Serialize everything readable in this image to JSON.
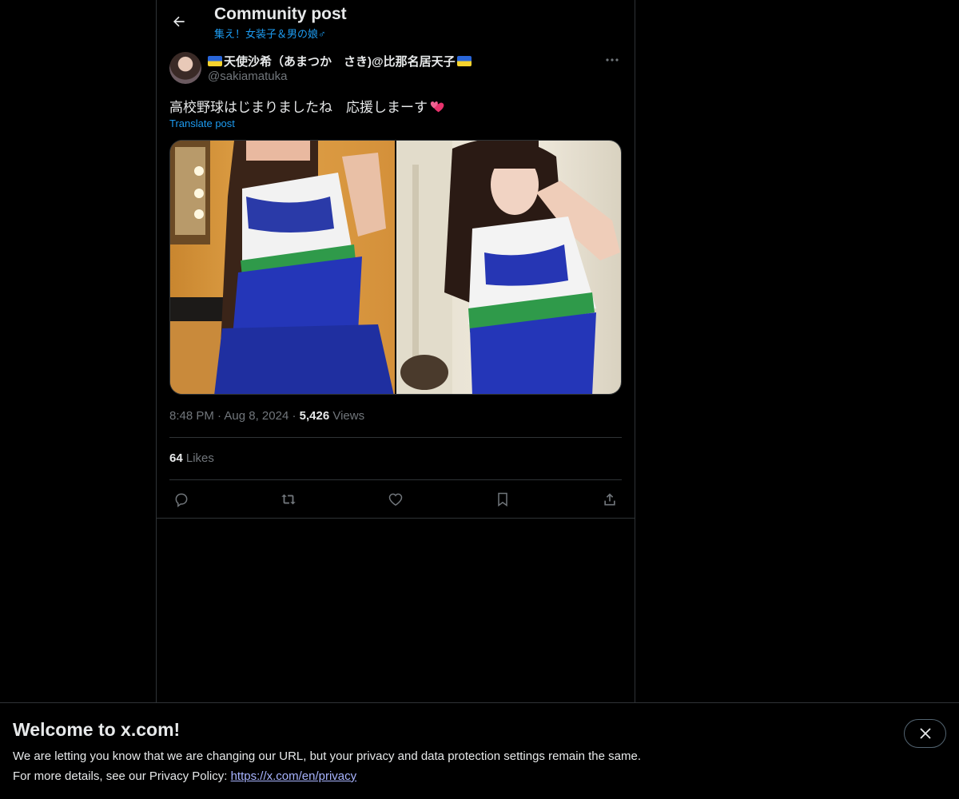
{
  "header": {
    "title": "Community post",
    "community": "集え！女装子＆男の娘♂"
  },
  "post": {
    "display_name": "天使沙希（あまつか　さき)@比那名居天子",
    "handle": "@sakiamatuka",
    "text": "高校野球はじまりましたね　応援しまーす",
    "translate_label": "Translate post",
    "time": "8:48 PM",
    "date": "Aug 8, 2024",
    "views_count": "5,426",
    "views_label": "Views",
    "likes_count": "64",
    "likes_label": "Likes"
  },
  "banner": {
    "title": "Welcome to x.com!",
    "line1": "We are letting you know that we are changing our URL, but your privacy and data protection settings remain the same.",
    "line2_prefix": "For more details, see our Privacy Policy: ",
    "link": "https://x.com/en/privacy"
  },
  "colors": {
    "background": "#000000",
    "text": "#e7e9ea",
    "muted": "#71767b",
    "accent": "#1d9bf0",
    "border": "#2f3336"
  },
  "icons": [
    "back-arrow-icon",
    "ukraine-flag-icon",
    "more-icon",
    "heart-emoji-icon",
    "reply-icon",
    "repost-icon",
    "like-icon",
    "bookmark-icon",
    "share-icon",
    "close-icon"
  ]
}
